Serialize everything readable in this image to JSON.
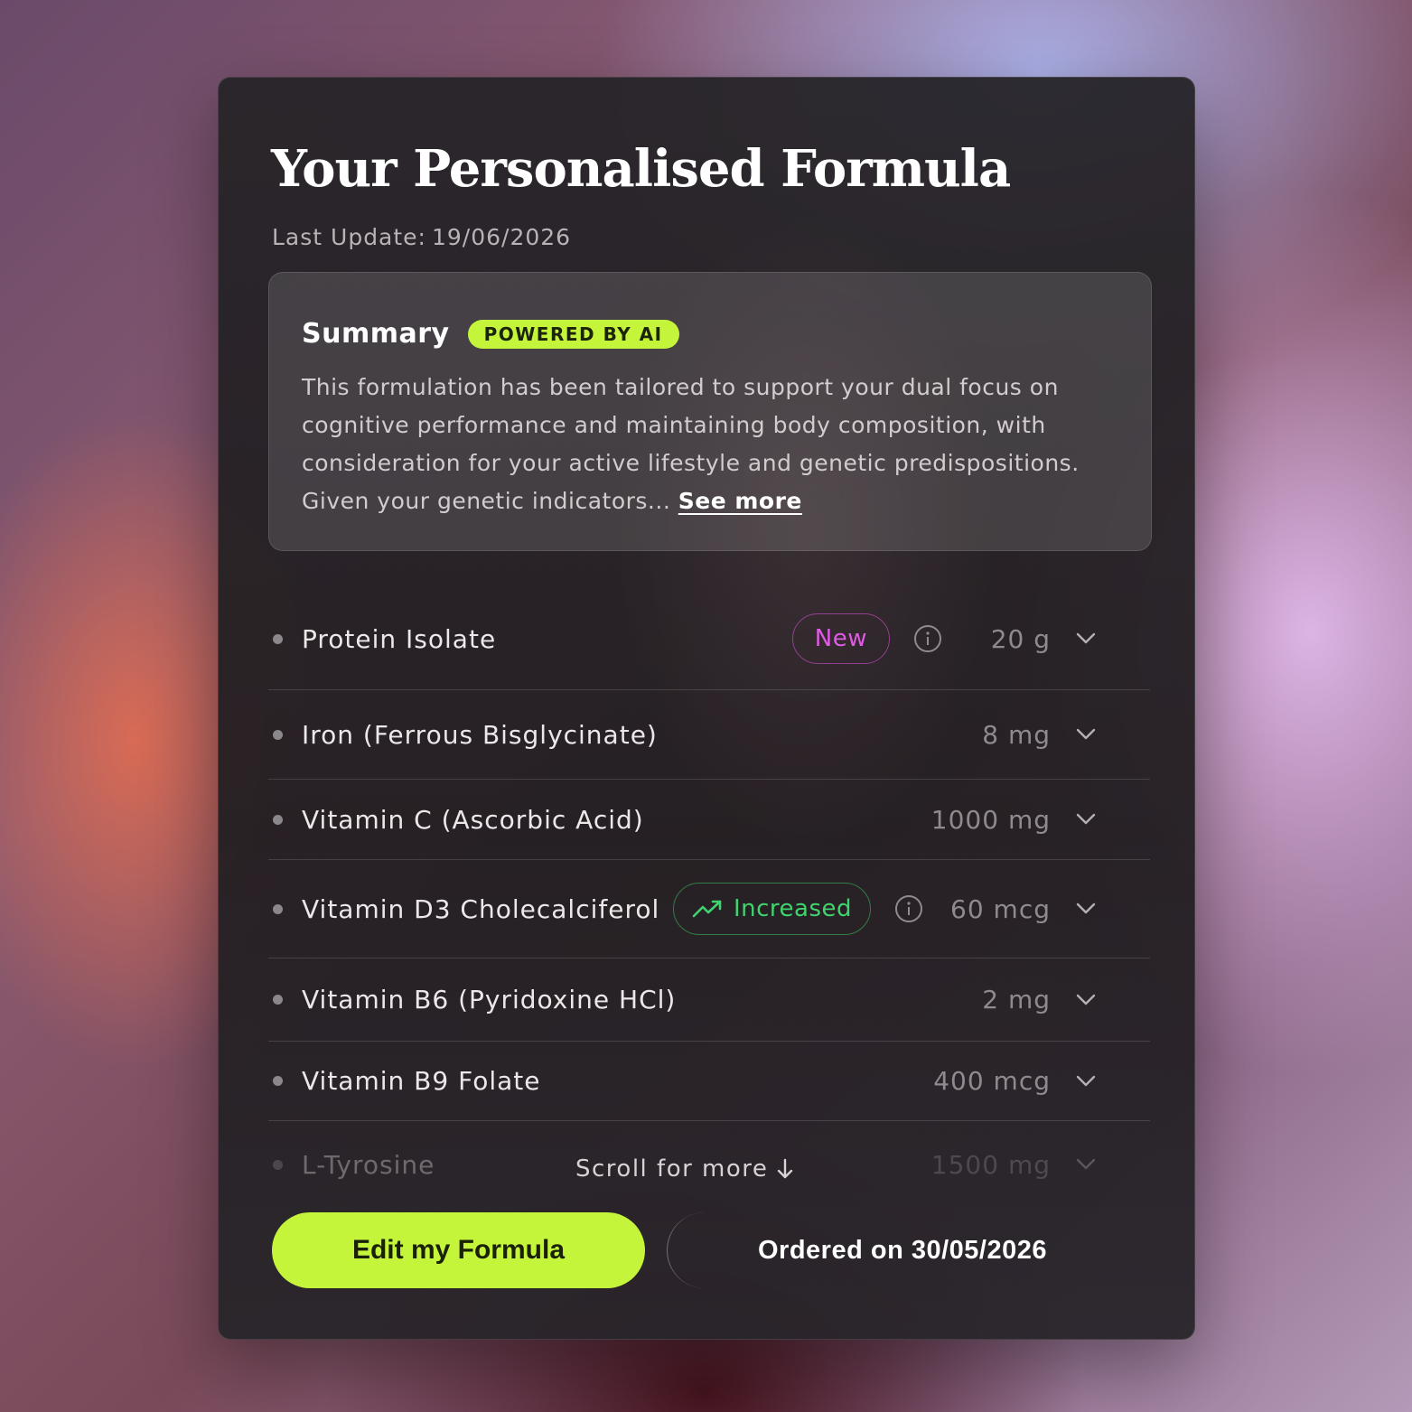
{
  "header": {
    "title": "Your Personalised Formula",
    "last_update_label": "Last Update:",
    "last_update_date": "19/06/2026"
  },
  "summary": {
    "title": "Summary",
    "badge": "POWERED BY AI",
    "text": "This formulation has been tailored to support your dual focus on cognitive performance and maintaining body composition, with consideration for your active lifestyle and genetic predispositions. Given your genetic indicators...",
    "see_more": "See more"
  },
  "ingredients": [
    {
      "name": "Protein Isolate",
      "amount": "20 g",
      "badge": "New",
      "info": true
    },
    {
      "name": "Iron (Ferrous Bisglycinate)",
      "amount": "8 mg"
    },
    {
      "name": "Vitamin C (Ascorbic Acid)",
      "amount": "1000 mg"
    },
    {
      "name": "Vitamin D3 Cholecalciferol",
      "amount": "60 mcg",
      "badge": "Increased",
      "info": true
    },
    {
      "name": "Vitamin B6 (Pyridoxine HCl)",
      "amount": "2 mg"
    },
    {
      "name": "Vitamin B9 Folate",
      "amount": "400 mcg"
    },
    {
      "name": "L-Tyrosine",
      "amount": "1500 mg"
    }
  ],
  "scroll_hint": "Scroll for more",
  "actions": {
    "edit_label": "Edit my Formula",
    "ordered_label": "Ordered on 30/05/2026"
  },
  "colors": {
    "accent": "#c4f53a",
    "new_badge": "#e05ae6",
    "increased_badge": "#3fd46d"
  }
}
